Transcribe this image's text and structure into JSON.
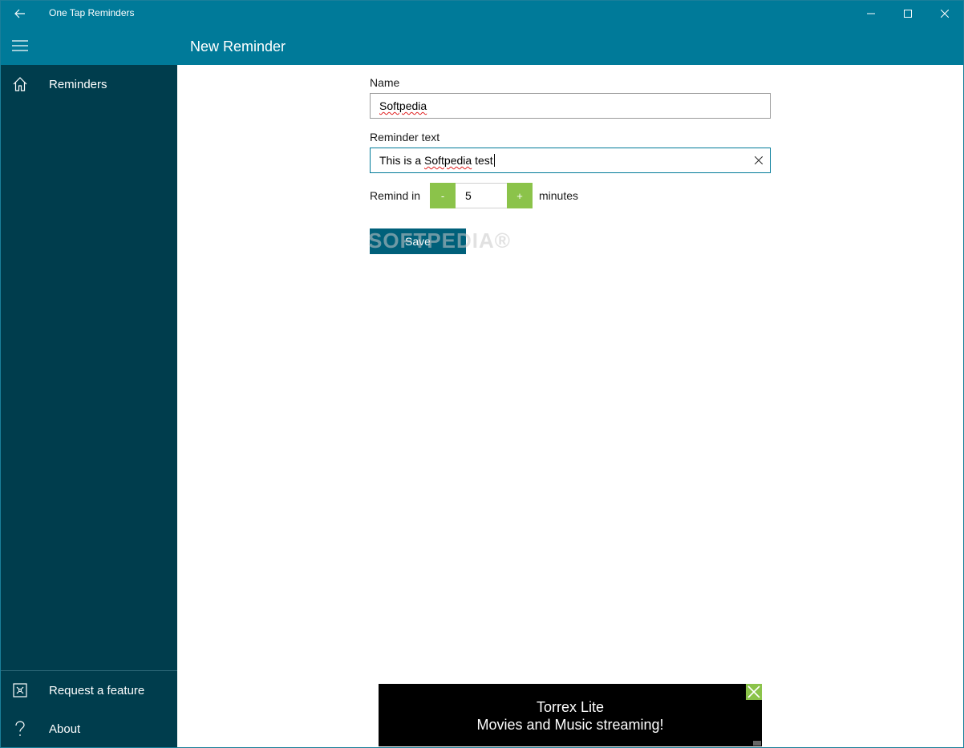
{
  "window": {
    "title": "One Tap Reminders",
    "accent_color": "#007a99",
    "sidebar_color": "#003d4d",
    "stepper_color": "#8bc34a",
    "save_color": "#00607a"
  },
  "titlebar": {
    "back_icon": "arrow-left-icon",
    "minimize_icon": "minimize-icon",
    "maximize_icon": "maximize-icon",
    "close_icon": "close-icon"
  },
  "header": {
    "menu_icon": "hamburger-icon",
    "page_title": "New Reminder"
  },
  "sidebar": {
    "items": [
      {
        "label": "Reminders",
        "icon": "home-icon"
      }
    ],
    "footer_items": [
      {
        "label": "Request a feature",
        "icon": "feature-icon"
      },
      {
        "label": "About",
        "icon": "question-icon"
      }
    ]
  },
  "form": {
    "name_label": "Name",
    "name_value": "Softpedia",
    "reminder_text_label": "Reminder text",
    "reminder_text_prefix": "This is a ",
    "reminder_text_misspelled": "Softpedia",
    "reminder_text_suffix": " test",
    "remind_in_label": "Remind in",
    "minus_label": "-",
    "minutes_value": "5",
    "plus_label": "+",
    "minutes_label": "minutes",
    "save_label": "Save"
  },
  "watermark": {
    "text": "SOFTPEDIA®"
  },
  "ad": {
    "line1": "Torrex Lite",
    "line2": "Movies and Music streaming!"
  }
}
